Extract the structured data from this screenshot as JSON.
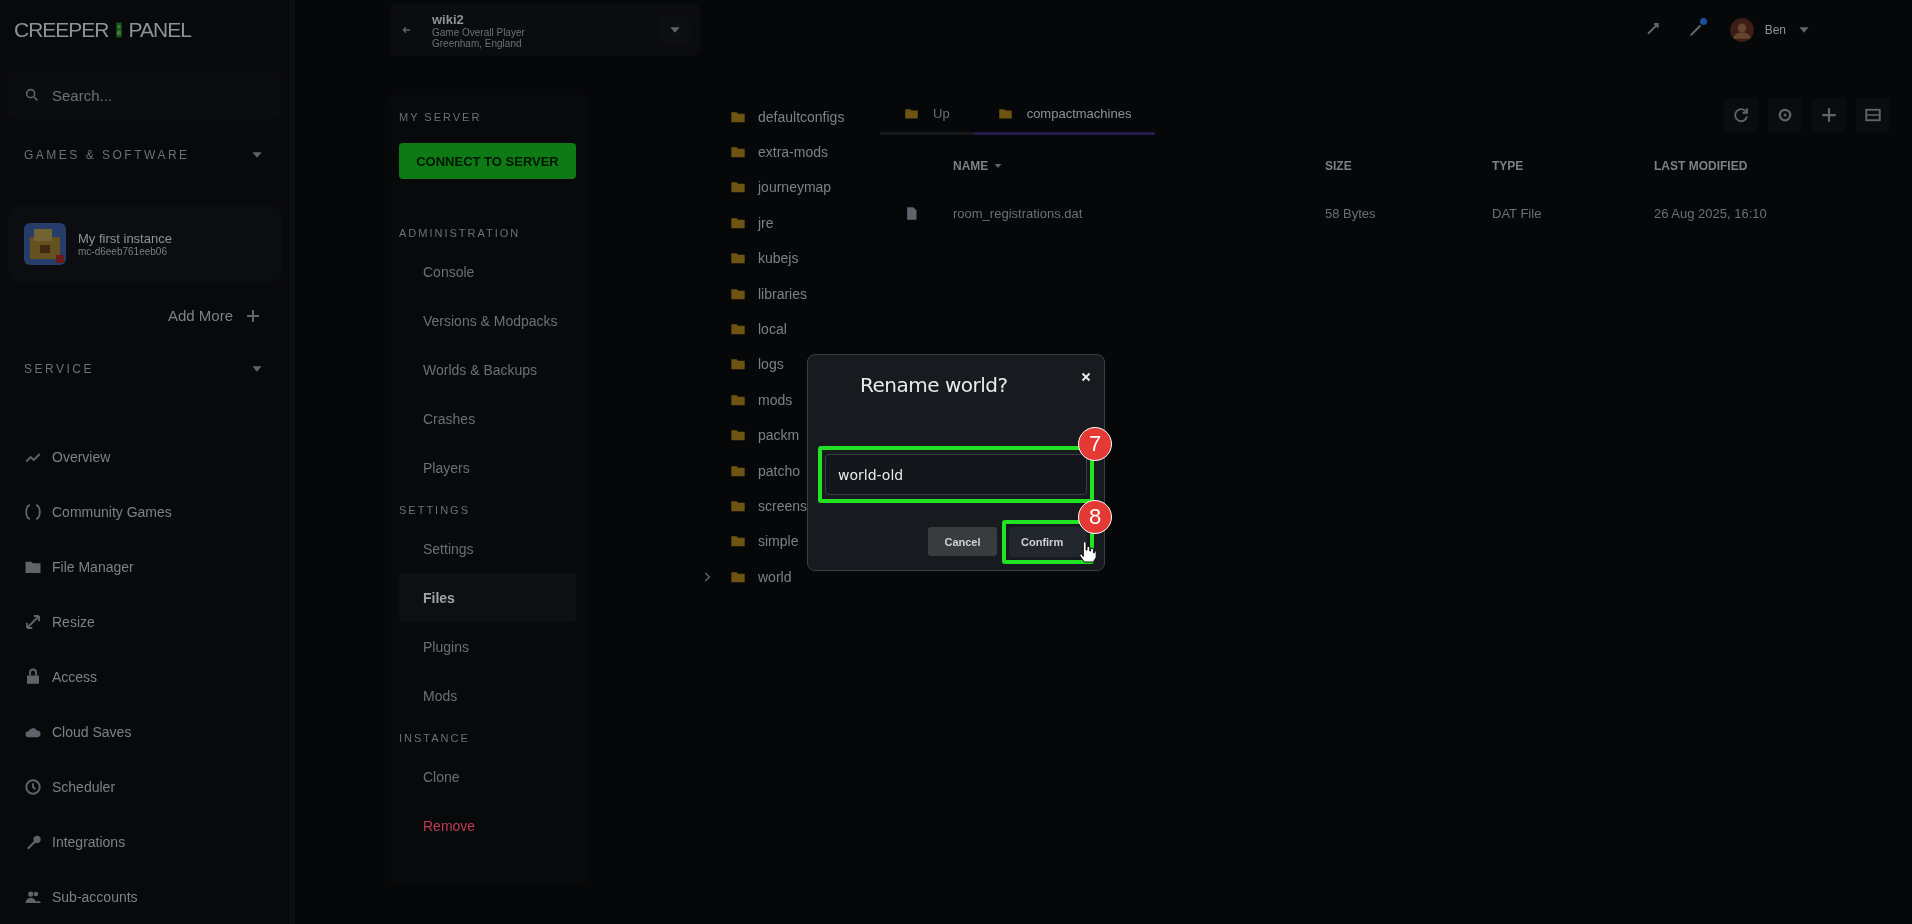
{
  "logo": {
    "left": "CREEPER",
    "right": "PANEL"
  },
  "sidebar": {
    "search": {
      "placeholder": "Search..."
    },
    "games_section": {
      "title": "GAMES & SOFTWARE",
      "expanded": true
    },
    "instances": [
      {
        "name": "My first instance",
        "id": "mc-d6eeb761eeb06"
      }
    ],
    "add_more": "Add More",
    "service_section": {
      "title": "SERVICE",
      "expanded": true
    },
    "items": [
      {
        "label": "Overview"
      },
      {
        "label": "Community Games"
      },
      {
        "label": "File Manager"
      },
      {
        "label": "Resize"
      },
      {
        "label": "Access"
      },
      {
        "label": "Cloud Saves"
      },
      {
        "label": "Scheduler"
      },
      {
        "label": "Integrations"
      },
      {
        "label": "Sub-accounts"
      }
    ]
  },
  "server_selector": {
    "name": "wiki2",
    "line_1": "Game Overall Player",
    "line_2": "Greenham, England"
  },
  "user": {
    "name": "Ben",
    "notification": true
  },
  "server_nav": {
    "title": "MY SERVER",
    "connect_button": "CONNECT TO SERVER",
    "sections": [
      {
        "title": "ADMINISTRATION",
        "items": [
          {
            "label": "Console",
            "selected": false,
            "kind": "normal"
          },
          {
            "label": "Versions & Modpacks",
            "selected": false,
            "kind": "normal"
          },
          {
            "label": "Worlds & Backups",
            "selected": false,
            "kind": "normal"
          },
          {
            "label": "Crashes",
            "selected": false,
            "kind": "normal"
          },
          {
            "label": "Players",
            "selected": false,
            "kind": "normal"
          }
        ]
      },
      {
        "title": "SETTINGS",
        "items": [
          {
            "label": "Settings",
            "selected": false,
            "kind": "normal"
          },
          {
            "label": "Files",
            "selected": true,
            "kind": "normal"
          },
          {
            "label": "Plugins",
            "selected": false,
            "kind": "normal"
          },
          {
            "label": "Mods",
            "selected": false,
            "kind": "normal"
          }
        ]
      },
      {
        "title": "INSTANCE",
        "items": [
          {
            "label": "Clone",
            "selected": false,
            "kind": "normal"
          },
          {
            "label": "Remove",
            "selected": false,
            "kind": "danger"
          }
        ]
      }
    ]
  },
  "folder_tree": [
    {
      "name": "defaultconfigs",
      "expandable": false
    },
    {
      "name": "extra-mods",
      "expandable": false
    },
    {
      "name": "journeymap",
      "expandable": false
    },
    {
      "name": "jre",
      "expandable": false
    },
    {
      "name": "kubejs",
      "expandable": false
    },
    {
      "name": "libraries",
      "expandable": false
    },
    {
      "name": "local",
      "expandable": false
    },
    {
      "name": "logs",
      "expandable": false
    },
    {
      "name": "mods",
      "expandable": false
    },
    {
      "name": "packm",
      "expandable": false
    },
    {
      "name": "patcho",
      "expandable": false
    },
    {
      "name": "screens",
      "expandable": false
    },
    {
      "name": "simple",
      "expandable": false
    },
    {
      "name": "world",
      "expandable": true
    }
  ],
  "file_browser": {
    "tabs": [
      {
        "label": "Up",
        "selected": false
      },
      {
        "label": "compactmachines",
        "selected": true
      }
    ],
    "columns": [
      "NAME",
      "SIZE",
      "TYPE",
      "LAST MODIFIED"
    ],
    "rows": [
      [
        "room_registrations.dat",
        "58 Bytes",
        "DAT File",
        "26 Aug 2025, 16:10"
      ]
    ]
  },
  "dialog": {
    "title": "Rename world?",
    "value": "world-old",
    "cancel": "Cancel",
    "confirm": "Confirm"
  },
  "annotations": [
    {
      "label": "7"
    },
    {
      "label": "8"
    }
  ]
}
